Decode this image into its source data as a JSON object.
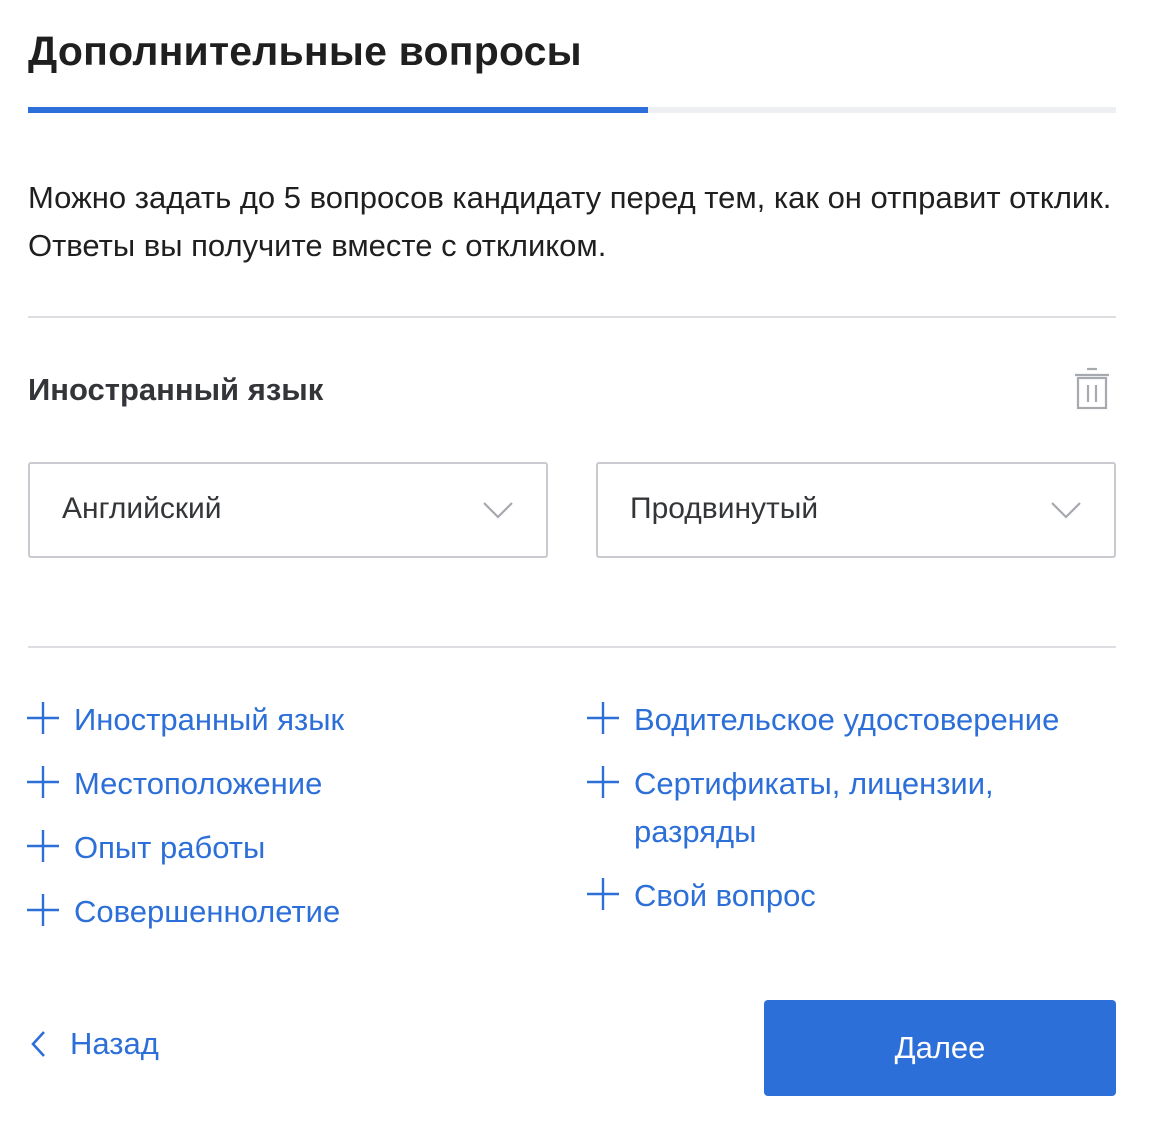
{
  "header": {
    "title": "Дополнительные вопросы"
  },
  "progress": {
    "fraction": 0.57
  },
  "description": "Можно задать до 5 вопросов кандидату перед тем, как он отправит отклик. Ответы вы получите вместе с откликом.",
  "question": {
    "title": "Иностранный язык",
    "delete_icon": "trash-icon",
    "language_select": {
      "value": "Английский",
      "icon": "chevron-down-icon"
    },
    "level_select": {
      "value": "Продвинутый",
      "icon": "chevron-down-icon"
    }
  },
  "add_options": {
    "left": [
      {
        "label": "Иностранный язык",
        "icon": "plus-icon"
      },
      {
        "label": "Местоположение",
        "icon": "plus-icon"
      },
      {
        "label": "Опыт работы",
        "icon": "plus-icon"
      },
      {
        "label": "Совершеннолетие",
        "icon": "plus-icon"
      }
    ],
    "right": [
      {
        "label": "Водительское удостоверение",
        "icon": "plus-icon"
      },
      {
        "label": "Сертификаты, лицензии, разряды",
        "icon": "plus-icon"
      },
      {
        "label": "Свой вопрос",
        "icon": "plus-icon"
      }
    ]
  },
  "footer": {
    "back_label": "Назад",
    "back_icon": "chevron-left-icon",
    "next_label": "Далее"
  },
  "colors": {
    "accent": "#2d6fd8",
    "text": "#1f1f1f",
    "border": "#c8cacf",
    "divider": "#dcdee2",
    "icon_muted": "#a6a9ae"
  }
}
